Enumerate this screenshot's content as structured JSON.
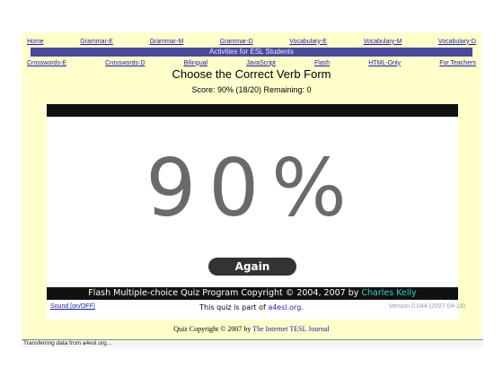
{
  "nav": {
    "row1": [
      "Home",
      "Grammar-E",
      "Grammar-M",
      "Grammar-D",
      "Vocabulary-E",
      "Vocabulary-M",
      "Vocabulary-D"
    ],
    "banner": "Activities for ESL Students",
    "row3": [
      "Crosswords-E",
      "Crosswords-D",
      "Bilingual",
      "JavaScript",
      "Flash",
      "HTML-Only",
      "For Teachers"
    ]
  },
  "quiz": {
    "title": "Choose the Correct Verb Form",
    "score_text": "Score: 90% (18/20)   Remaining: 0",
    "result_percent": "90%",
    "again_label": "Again"
  },
  "footer": {
    "copyright_prefix": "Flash Multiple-choice Quiz Program Copyright © 2004, 2007 by ",
    "copyright_author": "Charles Kelly",
    "sound_label": "Sound [on/OFF]",
    "part_of_prefix": "This quiz is part of ",
    "part_of_link": "a4esl.org.",
    "version": "Version 0.044 (2007-04-19)",
    "quiz_copyright_prefix": "Quiz Copyright © 2007 by ",
    "quiz_copyright_link": "The Internet TESL Journal"
  },
  "status_bar": {
    "text": "Transferring data from a4esl.org..."
  },
  "colors": {
    "page_bg": "#ffffcc",
    "banner_bg": "#4a4a9a",
    "link": "#1a1aa6",
    "author": "#33cccc"
  }
}
